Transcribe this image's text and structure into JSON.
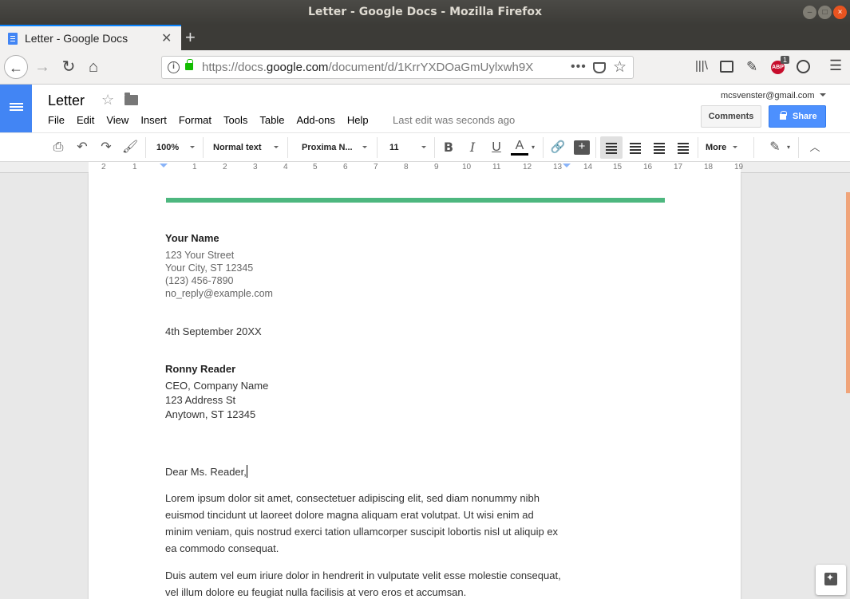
{
  "window": {
    "title": "Letter - Google Docs - Mozilla Firefox"
  },
  "browser": {
    "tab_title": "Letter - Google Docs",
    "url_prefix": "https://docs.",
    "url_domain": "google.com",
    "url_path": "/document/d/1KrrYXDOaGmUylxwh9X",
    "addon_badge": "1",
    "addon_label": "ABP"
  },
  "docs": {
    "title": "Letter",
    "menu": [
      "File",
      "Edit",
      "View",
      "Insert",
      "Format",
      "Tools",
      "Table",
      "Add-ons",
      "Help"
    ],
    "last_edit": "Last edit was seconds ago",
    "account": "mcsvenster@gmail.com",
    "comments_label": "Comments",
    "share_label": "Share"
  },
  "toolbar": {
    "zoom": "100%",
    "style": "Normal text",
    "font": "Proxima N...",
    "size": "11",
    "bold": "B",
    "italic": "I",
    "underline": "U",
    "textcolor": "A",
    "more": "More"
  },
  "ruler": {
    "ticks": [
      "2",
      "1",
      "1",
      "2",
      "3",
      "4",
      "5",
      "6",
      "7",
      "8",
      "9",
      "10",
      "11",
      "12",
      "13",
      "14",
      "15",
      "16",
      "17",
      "18",
      "19"
    ]
  },
  "letter": {
    "sender_name": "Your Name",
    "sender_street": "123 Your Street",
    "sender_city": "Your City, ST 12345",
    "sender_phone": "(123) 456-7890",
    "sender_email": "no_reply@example.com",
    "date": "4th September 20XX",
    "recipient_name": "Ronny Reader",
    "recipient_title": "CEO, Company Name",
    "recipient_street": "123 Address St",
    "recipient_city": "Anytown, ST 12345",
    "salutation": "Dear Ms. Reader,",
    "paragraph1": "Lorem ipsum dolor sit amet, consectetuer adipiscing elit, sed diam nonummy nibh euismod tincidunt ut laoreet dolore magna aliquam erat volutpat. Ut wisi enim ad minim veniam, quis nostrud exerci tation ullamcorper suscipit lobortis nisl ut aliquip ex ea commodo consequat.",
    "paragraph2": "Duis autem vel eum iriure dolor in hendrerit in vulputate velit esse molestie consequat, vel illum dolore eu feugiat nulla facilisis at vero eros et accumsan."
  },
  "colors": {
    "accent_green": "#4db77f",
    "docs_blue": "#4285f4",
    "share_blue": "#4d90fe"
  }
}
